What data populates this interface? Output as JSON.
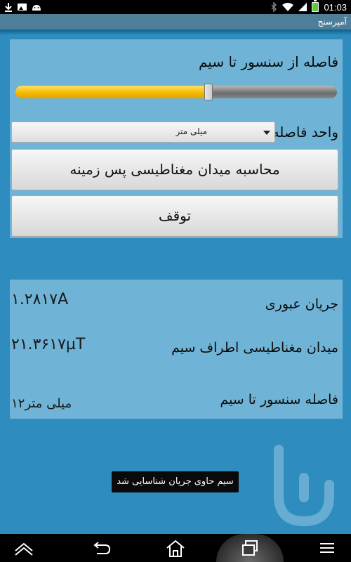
{
  "status_bar": {
    "time": "01:03",
    "icons": [
      "download-icon",
      "image-icon",
      "android-icon",
      "bluetooth-icon",
      "wifi-icon",
      "signal-icon",
      "battery-charging-icon"
    ]
  },
  "app": {
    "title": "آمپرسنج"
  },
  "settings": {
    "distance_label": "فاصله از سنسور تا سیم",
    "slider_level": 0.6,
    "unit_label": "واحد فاصله",
    "unit_selected": "میلی متر"
  },
  "buttons": {
    "calculate": "محاسبه میدان مغناطیسی پس زمینه",
    "stop": "توقف"
  },
  "results": {
    "current_label": "جریان عبوری",
    "current_value": "۱.۲۸۱۷A",
    "field_label": "میدان مغناطیسی اطراف سیم",
    "field_value": "۲۱.۳۶۱۷µT",
    "distance_label": "فاصله سنسور تا سیم",
    "distance_value": "۱۲میلی متر"
  },
  "toast": {
    "message": "سیم حاوی جریان شناسایی شد"
  },
  "nav_bar": {
    "icons": [
      "home-chevron-icon",
      "back-icon",
      "home-icon",
      "recent-apps-icon",
      "menu-icon"
    ]
  },
  "colors": {
    "background": "#2e8cbf",
    "panel": "#6fb4d7",
    "action_bar": "#4f7e99",
    "slider_fill": "#f5bb00"
  }
}
